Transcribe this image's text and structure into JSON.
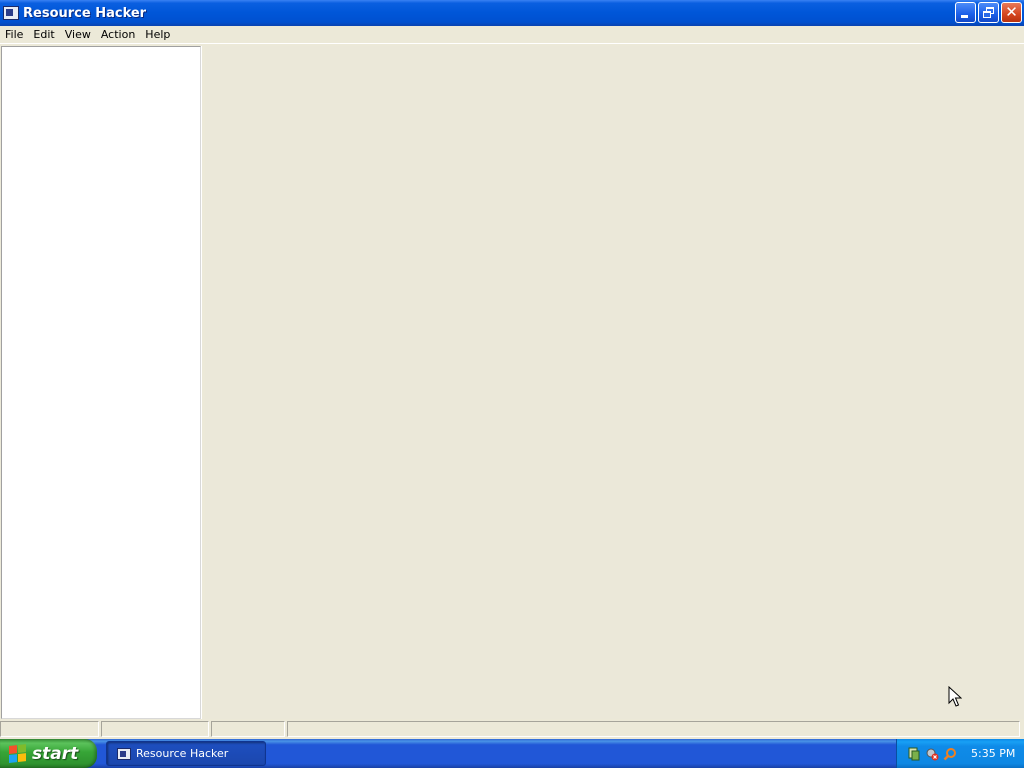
{
  "window": {
    "title": "Resource Hacker",
    "icon": "resource-hacker-icon"
  },
  "title_buttons": {
    "minimize": "minimize-icon",
    "restore": "restore-icon",
    "close": "close-icon"
  },
  "menu": {
    "items": [
      {
        "label": "File"
      },
      {
        "label": "Edit"
      },
      {
        "label": "View"
      },
      {
        "label": "Action"
      },
      {
        "label": "Help"
      }
    ]
  },
  "statusbar": {
    "panels": [
      "",
      "",
      "",
      ""
    ]
  },
  "taskbar": {
    "start_label": "start",
    "task_label": "Resource Hacker",
    "tray_icons": [
      "network-icon",
      "security-alert-icon",
      "search-icon"
    ],
    "clock": "5:35 PM"
  },
  "colors": {
    "titlebar": "#0056d8",
    "window_bg": "#ece9d8",
    "taskbar": "#2157d7",
    "start_button": "#37a537",
    "tray": "#0f8be8"
  }
}
